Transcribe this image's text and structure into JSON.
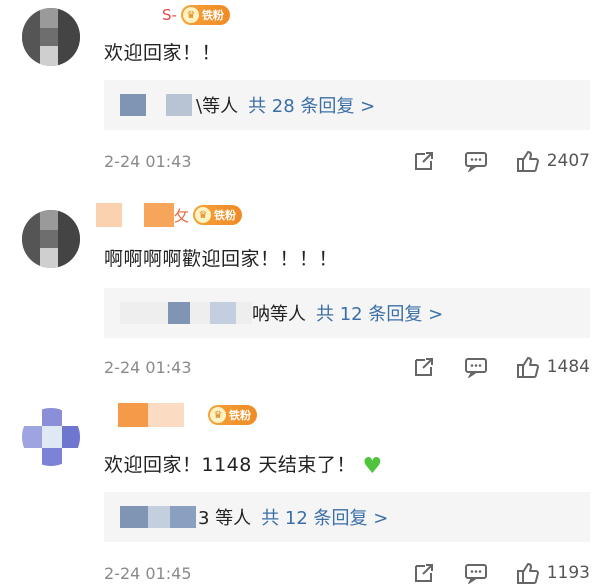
{
  "comments": [
    {
      "username_visible": "S-",
      "fan_badge": "铁粉",
      "text": "欢迎回家！！",
      "reply_suffix": "\\等人",
      "reply_link": "共 28 条回复 >",
      "time": "2-24 01:43",
      "likes": "2407"
    },
    {
      "username_visible": "攵",
      "fan_badge": "铁粉",
      "text": "啊啊啊啊歡迎回家！！！！",
      "reply_suffix": "呐等人",
      "reply_link": "共 12 条回复 >",
      "time": "2-24 01:43",
      "likes": "1484"
    },
    {
      "username_visible": "",
      "fan_badge": "铁粉",
      "text": "欢迎回家！1148 天结束了！",
      "reply_suffix": "3 等人",
      "reply_link": "共 12 条回复 >",
      "time": "2-24 01:45",
      "likes": "1193"
    }
  ],
  "icons": {
    "share": "share-icon",
    "comment": "comment-icon",
    "like": "thumbs-up-icon",
    "heart": "green-heart-emoji"
  },
  "colors": {
    "link": "#3b6fa8",
    "time": "#8a8a8a",
    "reply_bg": "#f5f5f5",
    "badge": "#f08a24",
    "heart": "#4fc43c"
  }
}
